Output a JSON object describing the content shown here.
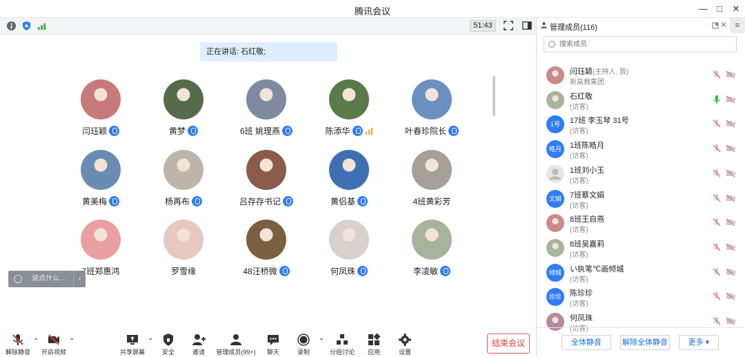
{
  "window": {
    "title": "腾讯会议"
  },
  "topbar": {
    "timer": "51:43"
  },
  "main": {
    "speaker_text": "正在讲话: 石红敬;",
    "participants": [
      {
        "name": "闫珏颖",
        "mic": true
      },
      {
        "name": "黄梦",
        "mic": true
      },
      {
        "name": "6班  姚理燕",
        "mic": true
      },
      {
        "name": "陈添华",
        "mic": true,
        "speaking": true
      },
      {
        "name": "叶春珍院长",
        "mic": true
      },
      {
        "name": "黄美梅",
        "mic": true
      },
      {
        "name": "杨再布",
        "mic": true
      },
      {
        "name": "吕存存书记",
        "mic": true
      },
      {
        "name": "黄侣基",
        "mic": true
      },
      {
        "name": "4班黄彩芳",
        "mic": false
      },
      {
        "name": "7班郑惠鸿",
        "mic": false
      },
      {
        "name": "罗雪缘",
        "mic": false
      },
      {
        "name": "48汪桥微",
        "mic": true
      },
      {
        "name": "何凤珠",
        "mic": true
      },
      {
        "name": "李凌敏",
        "mic": true
      }
    ],
    "chat_placeholder": "说点什么...",
    "chat_arrow": "‹"
  },
  "toolbar": {
    "unmute": "解除静音",
    "start_video": "开启视频",
    "share_screen": "共享屏幕",
    "security": "安全",
    "invite": "邀请",
    "manage_members": "管理成员(99+)",
    "chat": "聊天",
    "record": "录制",
    "breakout": "分组讨论",
    "apps": "应用",
    "settings": "设置",
    "end_meeting": "结束会议"
  },
  "panel": {
    "title": "管理成员(116)",
    "search_placeholder": "搜索成员",
    "members": [
      {
        "name": "闫珏颖",
        "tag": "(主持人, 我)",
        "sub": "新高教集团",
        "avatar": "photo"
      },
      {
        "name": "石红敬",
        "tag": "",
        "sub": "(访客)",
        "avatar": "photo",
        "mic_active": true
      },
      {
        "name": "17班 李玉琴 31号",
        "tag": "",
        "sub": "(访客)",
        "avatar": "1号"
      },
      {
        "name": "1班陈皓月",
        "tag": "",
        "sub": "(访客)",
        "avatar": "皓月"
      },
      {
        "name": "1班刘小玉",
        "tag": "",
        "sub": "(访客)",
        "avatar": "default"
      },
      {
        "name": "7班蔡文娟",
        "tag": "",
        "sub": "(访客)",
        "avatar": "文娟"
      },
      {
        "name": "8班王自燕",
        "tag": "",
        "sub": "(访客)",
        "avatar": "photo"
      },
      {
        "name": "8班吴嘉莉",
        "tag": "",
        "sub": "(访客)",
        "avatar": "photo"
      },
      {
        "name": "い执笔℃画倾城",
        "tag": "",
        "sub": "(访客)",
        "avatar": "倾城"
      },
      {
        "name": "陈珍珍",
        "tag": "",
        "sub": "(访客)",
        "avatar": "珍珍"
      },
      {
        "name": "何凤珠",
        "tag": "",
        "sub": "(访客)",
        "avatar": "photo"
      }
    ],
    "mute_all": "全体静音",
    "unmute_all": "解除全体静音",
    "more": "更多 ▾"
  },
  "colors": {
    "accent": "#2f7cf6",
    "danger": "#e53935",
    "speaker_bg": "#dfeefc"
  }
}
